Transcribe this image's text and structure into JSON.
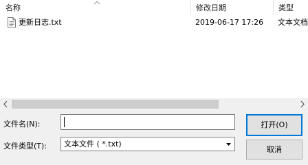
{
  "list": {
    "columns": {
      "name": "名称",
      "date_modified": "修改日期",
      "type": "类型"
    },
    "files": [
      {
        "name": "更新日志.txt",
        "date_modified": "2019-06-17 17:26",
        "type": "文本文档",
        "icon": "text-file-icon"
      }
    ]
  },
  "scrollbar": {
    "left_arrow": "‹",
    "right_arrow": "›"
  },
  "form": {
    "filename_label": "文件名(N):",
    "filename_value": "",
    "filetype_label": "文件类型(T):",
    "filetype_value": "文本文件 ( *.txt)"
  },
  "buttons": {
    "open_label": "打开(O)",
    "cancel_label": "取消"
  },
  "colors": {
    "default_button_border": "#0078d7",
    "scroll_thumb": "#cdcdcd"
  }
}
